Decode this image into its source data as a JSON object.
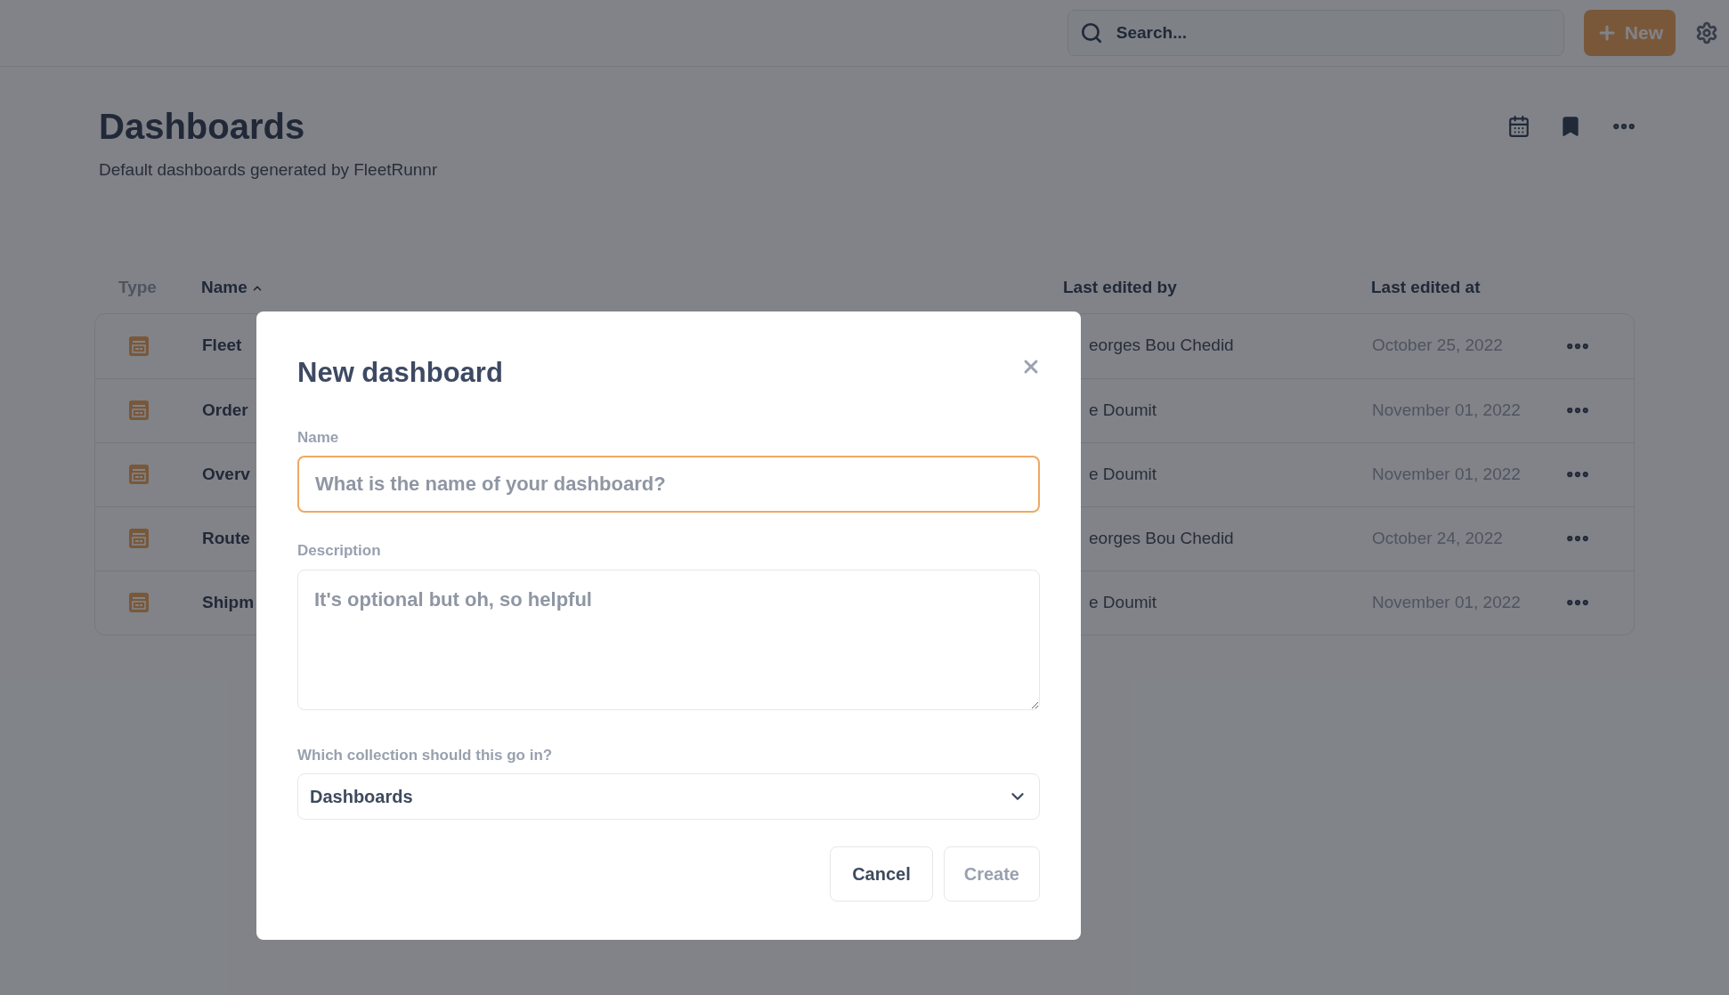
{
  "top_bar": {
    "search": {
      "placeholder": "Search..."
    },
    "new_button": "New"
  },
  "page": {
    "title": "Dashboards",
    "subtitle": "Default dashboards generated by FleetRunnr"
  },
  "table": {
    "columns": [
      {
        "label": "Type",
        "sorted": false
      },
      {
        "label": "Name",
        "sorted": true
      },
      {
        "label": "Last edited by",
        "sorted": false
      },
      {
        "label": "Last edited at",
        "sorted": false
      }
    ],
    "rows": [
      {
        "name": "Fleet",
        "edited_by": "eorges Bou Chedid",
        "edited_at": "October 25, 2022"
      },
      {
        "name": "Order",
        "edited_by": "e Doumit",
        "edited_at": "November 01, 2022"
      },
      {
        "name": "Overv",
        "edited_by": "e Doumit",
        "edited_at": "November 01, 2022"
      },
      {
        "name": "Route",
        "edited_by": "eorges Bou Chedid",
        "edited_at": "October 24, 2022"
      },
      {
        "name": "Shipm",
        "edited_by": "e Doumit",
        "edited_at": "November 01, 2022"
      }
    ]
  },
  "modal": {
    "title": "New dashboard",
    "name_field": {
      "label": "Name",
      "placeholder": "What is the name of your dashboard?",
      "focused": true
    },
    "description_field": {
      "label": "Description",
      "placeholder": "It's optional but oh, so helpful"
    },
    "collection_field": {
      "label": "Which collection should this go in?",
      "value": "Dashboards"
    },
    "buttons": [
      {
        "label": "Cancel",
        "disabled": false
      },
      {
        "label": "Create",
        "disabled": true
      }
    ]
  }
}
